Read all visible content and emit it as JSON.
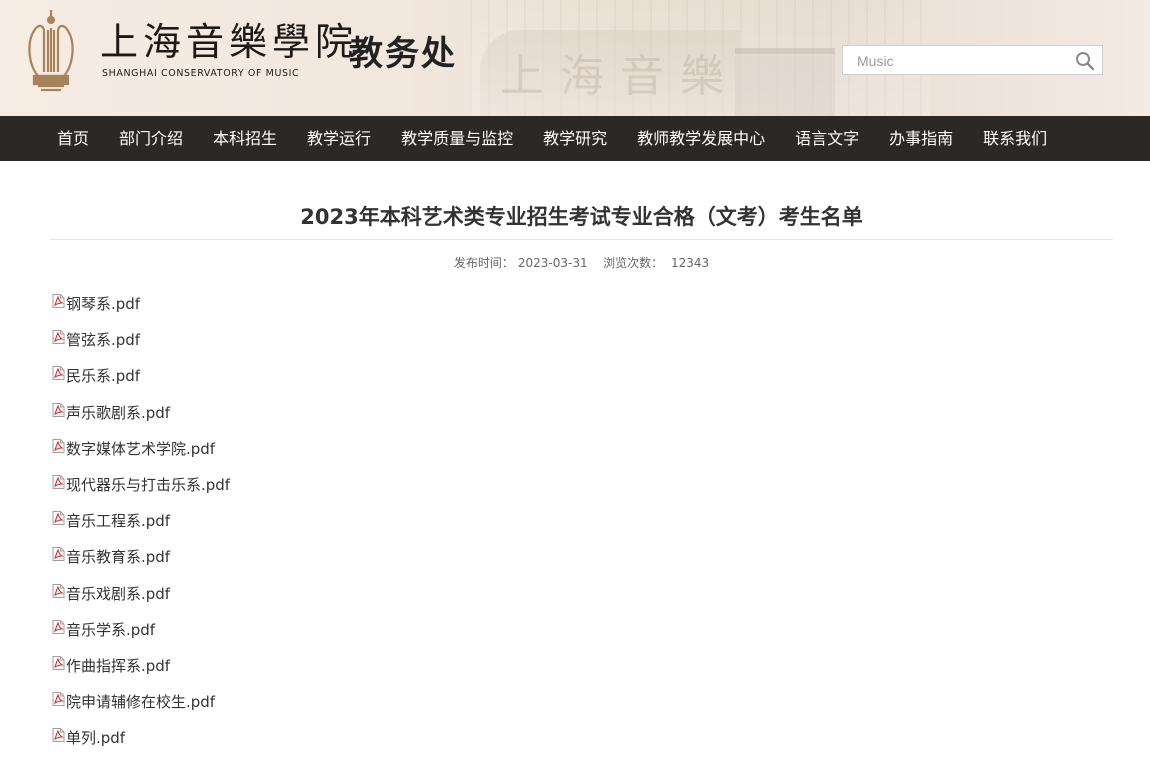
{
  "header": {
    "logo_cn": "上海音樂學院",
    "logo_en": "SHANGHAI CONSERVATORY OF MUSIC",
    "site_name": "教务处",
    "search": {
      "placeholder": "Music",
      "icon": "search-icon"
    }
  },
  "nav": {
    "items": [
      {
        "label": "首页"
      },
      {
        "label": "部门介绍"
      },
      {
        "label": "本科招生"
      },
      {
        "label": "教学运行"
      },
      {
        "label": "教学质量与监控"
      },
      {
        "label": "教学研究"
      },
      {
        "label": "教师教学发展中心"
      },
      {
        "label": "语言文字"
      },
      {
        "label": "办事指南"
      },
      {
        "label": "联系我们"
      }
    ]
  },
  "article": {
    "title": "2023年本科艺术类专业招生考试专业合格（文考）考生名单",
    "publish_label": "发布时间：",
    "publish_date": "2023-03-31",
    "views_label": "浏览次数：",
    "views": "12343",
    "attachments": [
      {
        "name": "钢琴系.pdf",
        "icon": "pdf-icon"
      },
      {
        "name": "管弦系.pdf",
        "icon": "pdf-icon"
      },
      {
        "name": "民乐系.pdf",
        "icon": "pdf-icon"
      },
      {
        "name": "声乐歌剧系.pdf",
        "icon": "pdf-icon"
      },
      {
        "name": "数字媒体艺术学院.pdf",
        "icon": "pdf-icon"
      },
      {
        "name": "现代器乐与打击乐系.pdf",
        "icon": "pdf-icon"
      },
      {
        "name": "音乐工程系.pdf",
        "icon": "pdf-icon"
      },
      {
        "name": "音乐教育系.pdf",
        "icon": "pdf-icon"
      },
      {
        "name": "音乐戏剧系.pdf",
        "icon": "pdf-icon"
      },
      {
        "name": "音乐学系.pdf",
        "icon": "pdf-icon"
      },
      {
        "name": "作曲指挥系.pdf",
        "icon": "pdf-icon"
      },
      {
        "name": "院申请辅修在校生.pdf",
        "icon": "pdf-icon"
      },
      {
        "name": "单列.pdf",
        "icon": "pdf-icon"
      }
    ]
  },
  "colors": {
    "nav_bg": "#2b2825",
    "logo_gold": "#a7835a",
    "pdf_red": "#d4322c"
  }
}
